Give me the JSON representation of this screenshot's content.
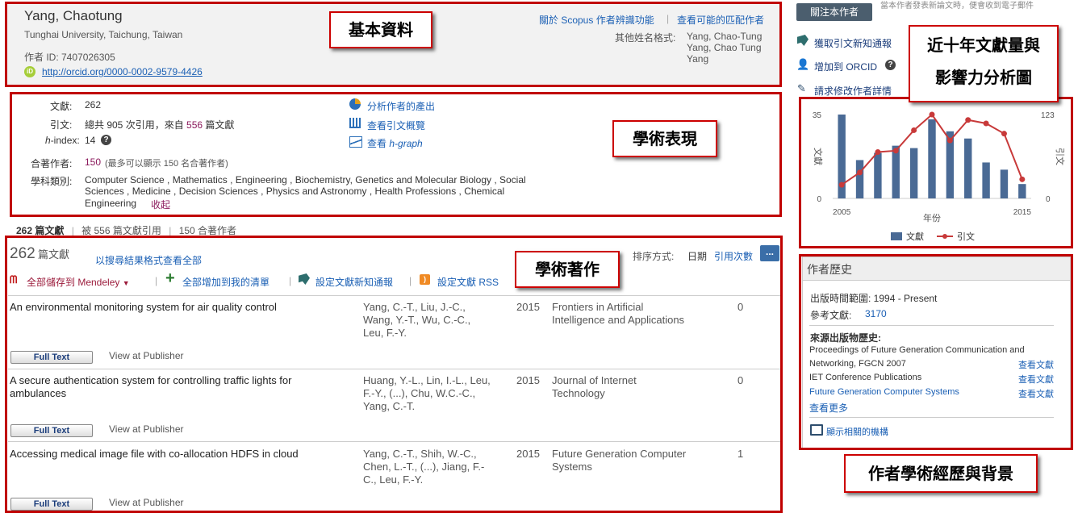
{
  "profile": {
    "name": "Yang, Chaotung",
    "affiliation": "Tunghai University, Taichung, Taiwan",
    "author_id": "作者 ID: 7407026305",
    "orcid": "http://orcid.org/0000-0002-9579-4426",
    "link_about": "關於 Scopus 作者辨識功能",
    "link_matches": "查看可能的匹配作者",
    "other_names_label": "其他姓名格式:",
    "other_names": [
      "Yang, Chao-Tung",
      "Yang, Chao Tung",
      "Yang"
    ]
  },
  "side_actions": {
    "follow_button": "關注本作者",
    "follow_note": "當本作者發表新論文時，便會收到電子郵件",
    "citation_alert": "獲取引文新知通報",
    "add_orcid": "增加到 ORCID",
    "request_edit": "請求修改作者詳情"
  },
  "metrics": {
    "docs_label": "文獻:",
    "docs_value": "262",
    "cites_label": "引文:",
    "cites_pre": "總共 905 次引用，來自",
    "cites_docs": "556",
    "cites_post": "篇文獻",
    "hindex_label": "-index:",
    "hindex_h": "h",
    "hindex_value": "14",
    "coauthors_label": "合著作者:",
    "coauthors_value": "150",
    "coauthors_note": "(最多可以顯示 150 名合著作者)",
    "subjects_label": "學科類別:",
    "subjects_line1": "Computer Science ,  Mathematics ,  Engineering ,  Biochemistry, Genetics and Molecular Biology ,  Social",
    "subjects_line2": "Sciences ,  Medicine ,  Decision Sciences ,  Physics and Astronomy ,  Health Professions ,  Chemical",
    "subjects_line3": "Engineering",
    "collapse": "收起",
    "analyze_output": "分析作者的產出",
    "view_citation_overview": "查看引文概覽",
    "view_hgraph_pre": "查看",
    "view_hgraph": "h-graph"
  },
  "tabs": {
    "docs": "262 篇文獻",
    "cited_by": "被 556 篇文獻引用",
    "coauthors": "150 合著作者"
  },
  "docs_panel": {
    "count": "262",
    "count_unit": "篇文獻",
    "view_all": "以搜尋結果格式查看全部",
    "sort_label": "排序方式:",
    "sort_date": "日期",
    "sort_cites": "引用次數",
    "more_btn": "...",
    "save_mendeley": "全部儲存到 Mendeley",
    "add_to_list": "全部增加到我的清單",
    "set_alert": "設定文獻新知通報",
    "set_rss": "設定文獻 RSS"
  },
  "documents": [
    {
      "title": "An environmental monitoring system for air quality control",
      "authors": [
        "Yang, C.-T., Liu, J.-C.,",
        "Wang, Y.-T., Wu, C.-C.,",
        "Leu, F.-Y."
      ],
      "year": "2015",
      "source": [
        "Frontiers in Artificial",
        "Intelligence and Applications"
      ],
      "cites": "0",
      "full_text": "Full Text",
      "view_publisher": "View at Publisher"
    },
    {
      "title": "A secure authentication system for controlling traffic lights for ambulances",
      "authors": [
        "Huang, Y.-L., Lin, I.-L., Leu,",
        "F.-Y., (...), Chu, W.C.-C.,",
        "Yang, C.-T."
      ],
      "year": "2015",
      "source": [
        "Journal of Internet",
        "Technology"
      ],
      "cites": "0",
      "full_text": "Full Text",
      "view_publisher": "View at Publisher"
    },
    {
      "title": "Accessing medical image file with co-allocation HDFS in cloud",
      "authors": [
        "Yang, C.-T., Shih, W.-C.,",
        "Chen, L.-T., (...), Jiang, F.-",
        "C., Leu, F.-Y."
      ],
      "year": "2015",
      "source": [
        "Future Generation Computer",
        "Systems"
      ],
      "cites": "1",
      "full_text": "Full Text",
      "view_publisher": "View at Publisher"
    }
  ],
  "history": {
    "title": "作者歷史",
    "range": "出版時間範圍: 1994 - Present",
    "refs_label": "參考文獻:",
    "refs_value": "3170",
    "sources_title": "來源出版物歷史:",
    "sources": [
      {
        "name": "Proceedings of Future Generation Communication and Networking, FGCN 2007",
        "action": "查看文獻"
      },
      {
        "name": "IET Conference Publications",
        "action": "查看文獻"
      },
      {
        "name": "Future Generation Computer Systems",
        "action": "查看文獻"
      }
    ],
    "view_more": "查看更多",
    "related": "顯示相關的機構"
  },
  "callouts": {
    "basic": "基本資料",
    "performance": "學術表現",
    "works": "學術著作",
    "chart_l1": "近十年文獻量與",
    "chart_l2": "影響力分析圖",
    "history": "作者學術經歷與背景"
  },
  "chart_data": {
    "type": "bar",
    "title": "",
    "xlabel": "年份",
    "ylabel": "文獻",
    "y2label": "引文",
    "categories": [
      "2005",
      "2006",
      "2007",
      "2008",
      "2009",
      "2010",
      "2011",
      "2012",
      "2013",
      "2014",
      "2015"
    ],
    "x_tick_labels": [
      "2005",
      "2015"
    ],
    "ylim": [
      0,
      35
    ],
    "y2lim": [
      0,
      123
    ],
    "series": [
      {
        "name": "文獻",
        "type": "bar",
        "axis": "left",
        "values": [
          35,
          16,
          19,
          22,
          21,
          33,
          28,
          25,
          15,
          12,
          6
        ]
      },
      {
        "name": "引文",
        "type": "line",
        "axis": "right",
        "values": [
          20,
          38,
          68,
          70,
          100,
          123,
          85,
          115,
          110,
          95,
          28
        ]
      }
    ],
    "legend": "bottom",
    "colors": {
      "bars": "#4a6a95",
      "line": "#c83a3a"
    }
  }
}
